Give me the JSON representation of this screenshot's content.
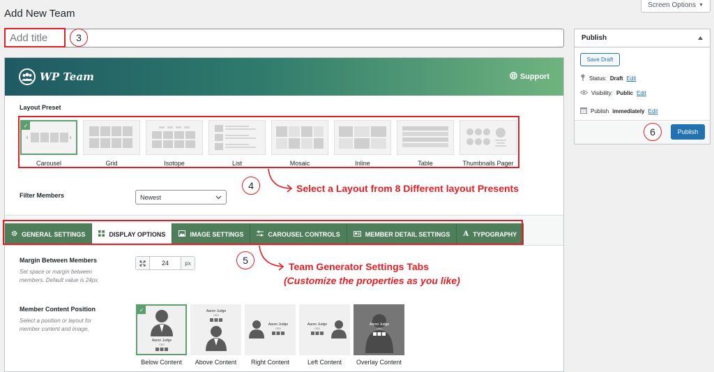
{
  "page": {
    "title": "Add New Team"
  },
  "screen_options": {
    "label": "Screen Options",
    "arrow": "▼"
  },
  "title_field": {
    "placeholder": "Add title"
  },
  "annotations": {
    "n3": "3",
    "n4": "4",
    "n5": "5",
    "n6": "6",
    "layout_note": "Select a Layout from  8 Different layout Presents",
    "tabs_note": "Team Generator Settings Tabs",
    "tabs_sub": "(Customize the properties as you like)"
  },
  "header": {
    "brand": "WP Team",
    "support": "Support"
  },
  "layout": {
    "label": "Layout Preset",
    "presets": [
      {
        "label": "Carousel",
        "selected": true
      },
      {
        "label": "Grid",
        "selected": false
      },
      {
        "label": "Isotope",
        "selected": false
      },
      {
        "label": "List",
        "selected": false
      },
      {
        "label": "Mosaic",
        "selected": false
      },
      {
        "label": "Inline",
        "selected": false
      },
      {
        "label": "Table",
        "selected": false
      },
      {
        "label": "Thumbnails Pager",
        "selected": false
      }
    ]
  },
  "filter": {
    "label": "Filter Members",
    "value": "Newest"
  },
  "tabs": [
    {
      "label": "GENERAL SETTINGS",
      "icon": "gear-icon",
      "active": false
    },
    {
      "label": "DISPLAY OPTIONS",
      "icon": "grid-icon",
      "active": true
    },
    {
      "label": "IMAGE SETTINGS",
      "icon": "image-icon",
      "active": false
    },
    {
      "label": "CAROUSEL CONTROLS",
      "icon": "sliders-icon",
      "active": false
    },
    {
      "label": "MEMBER DETAIL SETTINGS",
      "icon": "id-card-icon",
      "active": false
    },
    {
      "label": "TYPOGRAPHY",
      "icon": "font-icon",
      "active": false
    }
  ],
  "margin": {
    "title": "Margin Between Members",
    "desc1": "Set space or margin between",
    "desc2": "members. Default value is 24px.",
    "value": "24",
    "unit": "px"
  },
  "content_position": {
    "title": "Member Content Position",
    "desc1": "Select a position or layout for",
    "desc2": "member content and image.",
    "member_name": "Aaron Judge",
    "member_role": "CEO",
    "options": [
      {
        "label": "Below Content",
        "selected": true
      },
      {
        "label": "Above Content",
        "selected": false
      },
      {
        "label": "Right Content",
        "selected": false
      },
      {
        "label": "Left Content",
        "selected": false
      },
      {
        "label": "Overlay Content",
        "selected": false
      }
    ]
  },
  "publish": {
    "title": "Publish",
    "save_draft": "Save Draft",
    "status_label": "Status:",
    "status_value": "Draft",
    "visibility_label": "Visibility:",
    "visibility_value": "Public",
    "publish_label": "Publish",
    "publish_value": "immediately",
    "edit": "Edit",
    "button": "Publish"
  },
  "colors": {
    "accent": "#e31e24",
    "brand_green": "#4f7e5a",
    "wp_blue": "#2271b1"
  }
}
